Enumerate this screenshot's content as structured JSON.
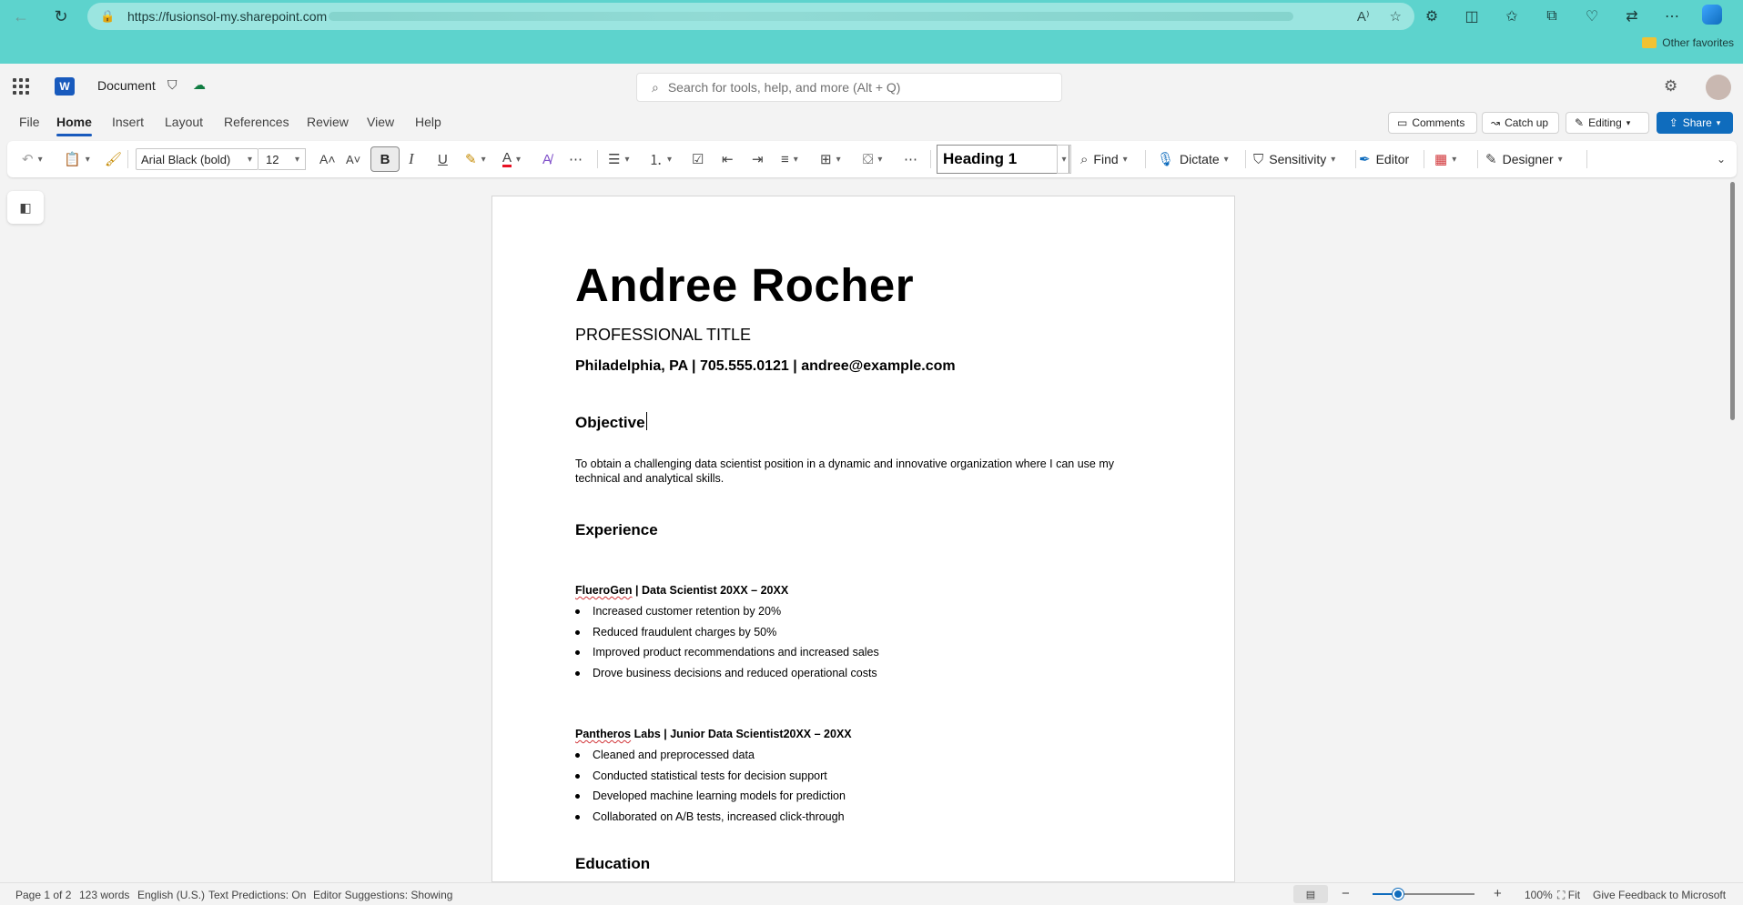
{
  "browser": {
    "url": "https://fusionsol-my.sharepoint.com",
    "favorites_label": "Other favorites"
  },
  "app": {
    "doc_name": "Document",
    "search_placeholder": "Search for tools, help, and more (Alt + Q)"
  },
  "tabs": [
    "File",
    "Home",
    "Insert",
    "Layout",
    "References",
    "Review",
    "View",
    "Help"
  ],
  "active_tab": "Home",
  "header_actions": {
    "comments": "Comments",
    "catch_up": "Catch up",
    "editing": "Editing",
    "share": "Share"
  },
  "toolbar": {
    "font": "Arial Black (bold)",
    "size": "12",
    "bold": "B",
    "italic": "I",
    "underline": "U",
    "style": "Heading 1",
    "find": "Find",
    "dictate": "Dictate",
    "sensitivity": "Sensitivity",
    "editor": "Editor",
    "designer": "Designer"
  },
  "document": {
    "name": "Andree Rocher",
    "professional_title": "PROFESSIONAL TITLE",
    "contact": "Philadelphia, PA | 705.555.0121 | andree@example.com",
    "objective_heading": "Objective",
    "objective_text": "To obtain a challenging data scientist position in a dynamic and innovative organization where I can use my technical and analytical skills.",
    "experience_heading": "Experience",
    "jobs": [
      {
        "company": "FlueroGen",
        "rest": " | Data Scientist 20XX – 20XX",
        "bullets": [
          "Increased customer retention by 20%",
          "Reduced fraudulent charges by 50%",
          "Improved product recommendations and increased sales",
          "Drove business decisions and reduced operational costs"
        ]
      },
      {
        "company": "Pantheros",
        "rest": " Labs | Junior Data Scientist20XX – 20XX",
        "bullets": [
          "Cleaned and preprocessed data",
          "Conducted statistical tests for decision support",
          "Developed machine learning models for prediction",
          "Collaborated on A/B tests, increased click-through"
        ]
      }
    ],
    "education_heading": "Education"
  },
  "status": {
    "page": "Page 1 of 2",
    "words": "123 words",
    "language": "English (U.S.)",
    "text_predictions": "Text Predictions: On",
    "editor_suggestions": "Editor Suggestions: Showing",
    "zoom": "100%",
    "zoom_level": 0.25,
    "fit": "Fit",
    "feedback": "Give Feedback to Microsoft"
  }
}
